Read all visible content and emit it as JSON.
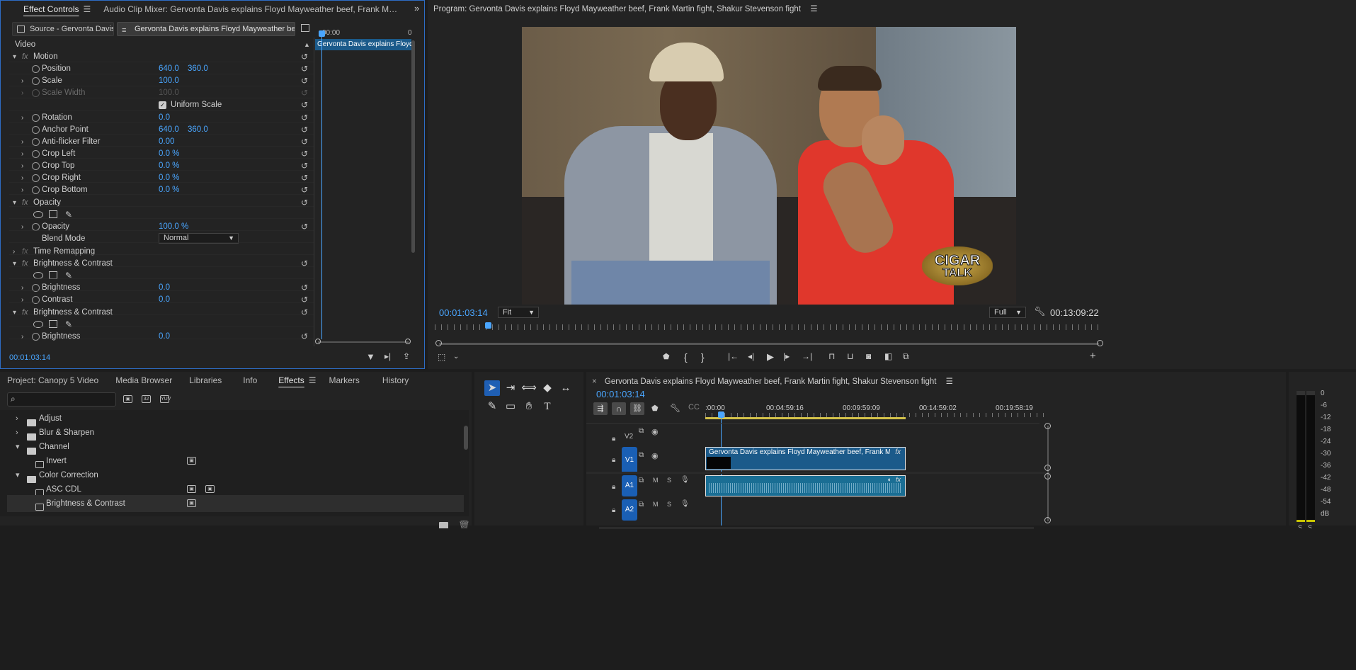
{
  "effect_controls": {
    "tab_effect_controls": "Effect Controls",
    "tab_audio_mixer": "Audio Clip Mixer: Gervonta Davis explains Floyd Mayweather beef, Frank Martin fight, Shakur Stevenson fight",
    "source_tab": "Source - Gervonta Davis e...",
    "sequence_tab": "Gervonta Davis explains Floyd Mayweather beef, Fran...",
    "ruler_start": "00:00",
    "ruler_end": "0",
    "clip_label": "Gervonta Davis explains Floyd Ma",
    "section": "Video",
    "motion": "Motion",
    "position": {
      "label": "Position",
      "x": "640.0",
      "y": "360.0"
    },
    "scale": {
      "label": "Scale",
      "value": "100.0"
    },
    "scale_width": {
      "label": "Scale Width",
      "value": "100.0"
    },
    "uniform_scale": "Uniform Scale",
    "rotation": {
      "label": "Rotation",
      "value": "0.0"
    },
    "anchor": {
      "label": "Anchor Point",
      "x": "640.0",
      "y": "360.0"
    },
    "antiflicker": {
      "label": "Anti-flicker Filter",
      "value": "0.00"
    },
    "crop_left": {
      "label": "Crop Left",
      "value": "0.0 %"
    },
    "crop_top": {
      "label": "Crop Top",
      "value": "0.0 %"
    },
    "crop_right": {
      "label": "Crop Right",
      "value": "0.0 %"
    },
    "crop_bottom": {
      "label": "Crop Bottom",
      "value": "0.0 %"
    },
    "opacity_group": "Opacity",
    "opacity": {
      "label": "Opacity",
      "value": "100.0 %"
    },
    "blend": {
      "label": "Blend Mode",
      "value": "Normal"
    },
    "time_remap": "Time Remapping",
    "bc1": "Brightness & Contrast",
    "brightness1": {
      "label": "Brightness",
      "value": "0.0"
    },
    "contrast1": {
      "label": "Contrast",
      "value": "0.0"
    },
    "bc2": "Brightness & Contrast",
    "brightness2": {
      "label": "Brightness",
      "value": "0.0"
    },
    "timecode": "00:01:03:14"
  },
  "program": {
    "title": "Program: Gervonta Davis explains Floyd Mayweather beef, Frank Martin fight, Shakur Stevenson fight",
    "timecode": "00:01:03:14",
    "fit": "Fit",
    "quality": "Full",
    "duration": "00:13:09:22",
    "logo_text_1": "CIGAR",
    "logo_text_2": "TALK"
  },
  "project": {
    "tabs": [
      "Project: Canopy 5 Video",
      "Media Browser",
      "Libraries",
      "Info",
      "Effects",
      "Markers",
      "History"
    ],
    "search_placeholder": "",
    "accel_labels": [
      "32",
      "YUV"
    ],
    "items": [
      {
        "label": "Adjust"
      },
      {
        "label": "Blur & Sharpen"
      },
      {
        "label": "Channel"
      },
      {
        "label": "Invert"
      },
      {
        "label": "Color Correction"
      },
      {
        "label": "ASC CDL"
      },
      {
        "label": "Brightness & Contrast"
      }
    ]
  },
  "timeline": {
    "title": "Gervonta Davis explains Floyd Mayweather beef, Frank Martin fight, Shakur Stevenson fight",
    "timecode": "00:01:03:14",
    "ruler": [
      ":00:00",
      "00:04:59:16",
      "00:09:59:09",
      "00:14:59:02",
      "00:19:58:19"
    ],
    "tracks": {
      "v2": "V2",
      "v1": "V1",
      "a1": "A1",
      "a2": "A2",
      "m": "M",
      "s": "S"
    },
    "clip_title": "Gervonta Davis explains Floyd Mayweather beef, Frank Martin fight...",
    "fx": "fx"
  },
  "meter": {
    "labels": [
      "0",
      "-6",
      "-12",
      "-18",
      "-24",
      "-30",
      "-36",
      "-42",
      "-48",
      "-54",
      "dB"
    ],
    "solo": [
      "S",
      "S"
    ]
  },
  "colors": {
    "accent": "#4aa6ff",
    "track": "#1a5fb4",
    "clip_video": "#1b5a8a",
    "clip_audio": "#1a6e94"
  }
}
